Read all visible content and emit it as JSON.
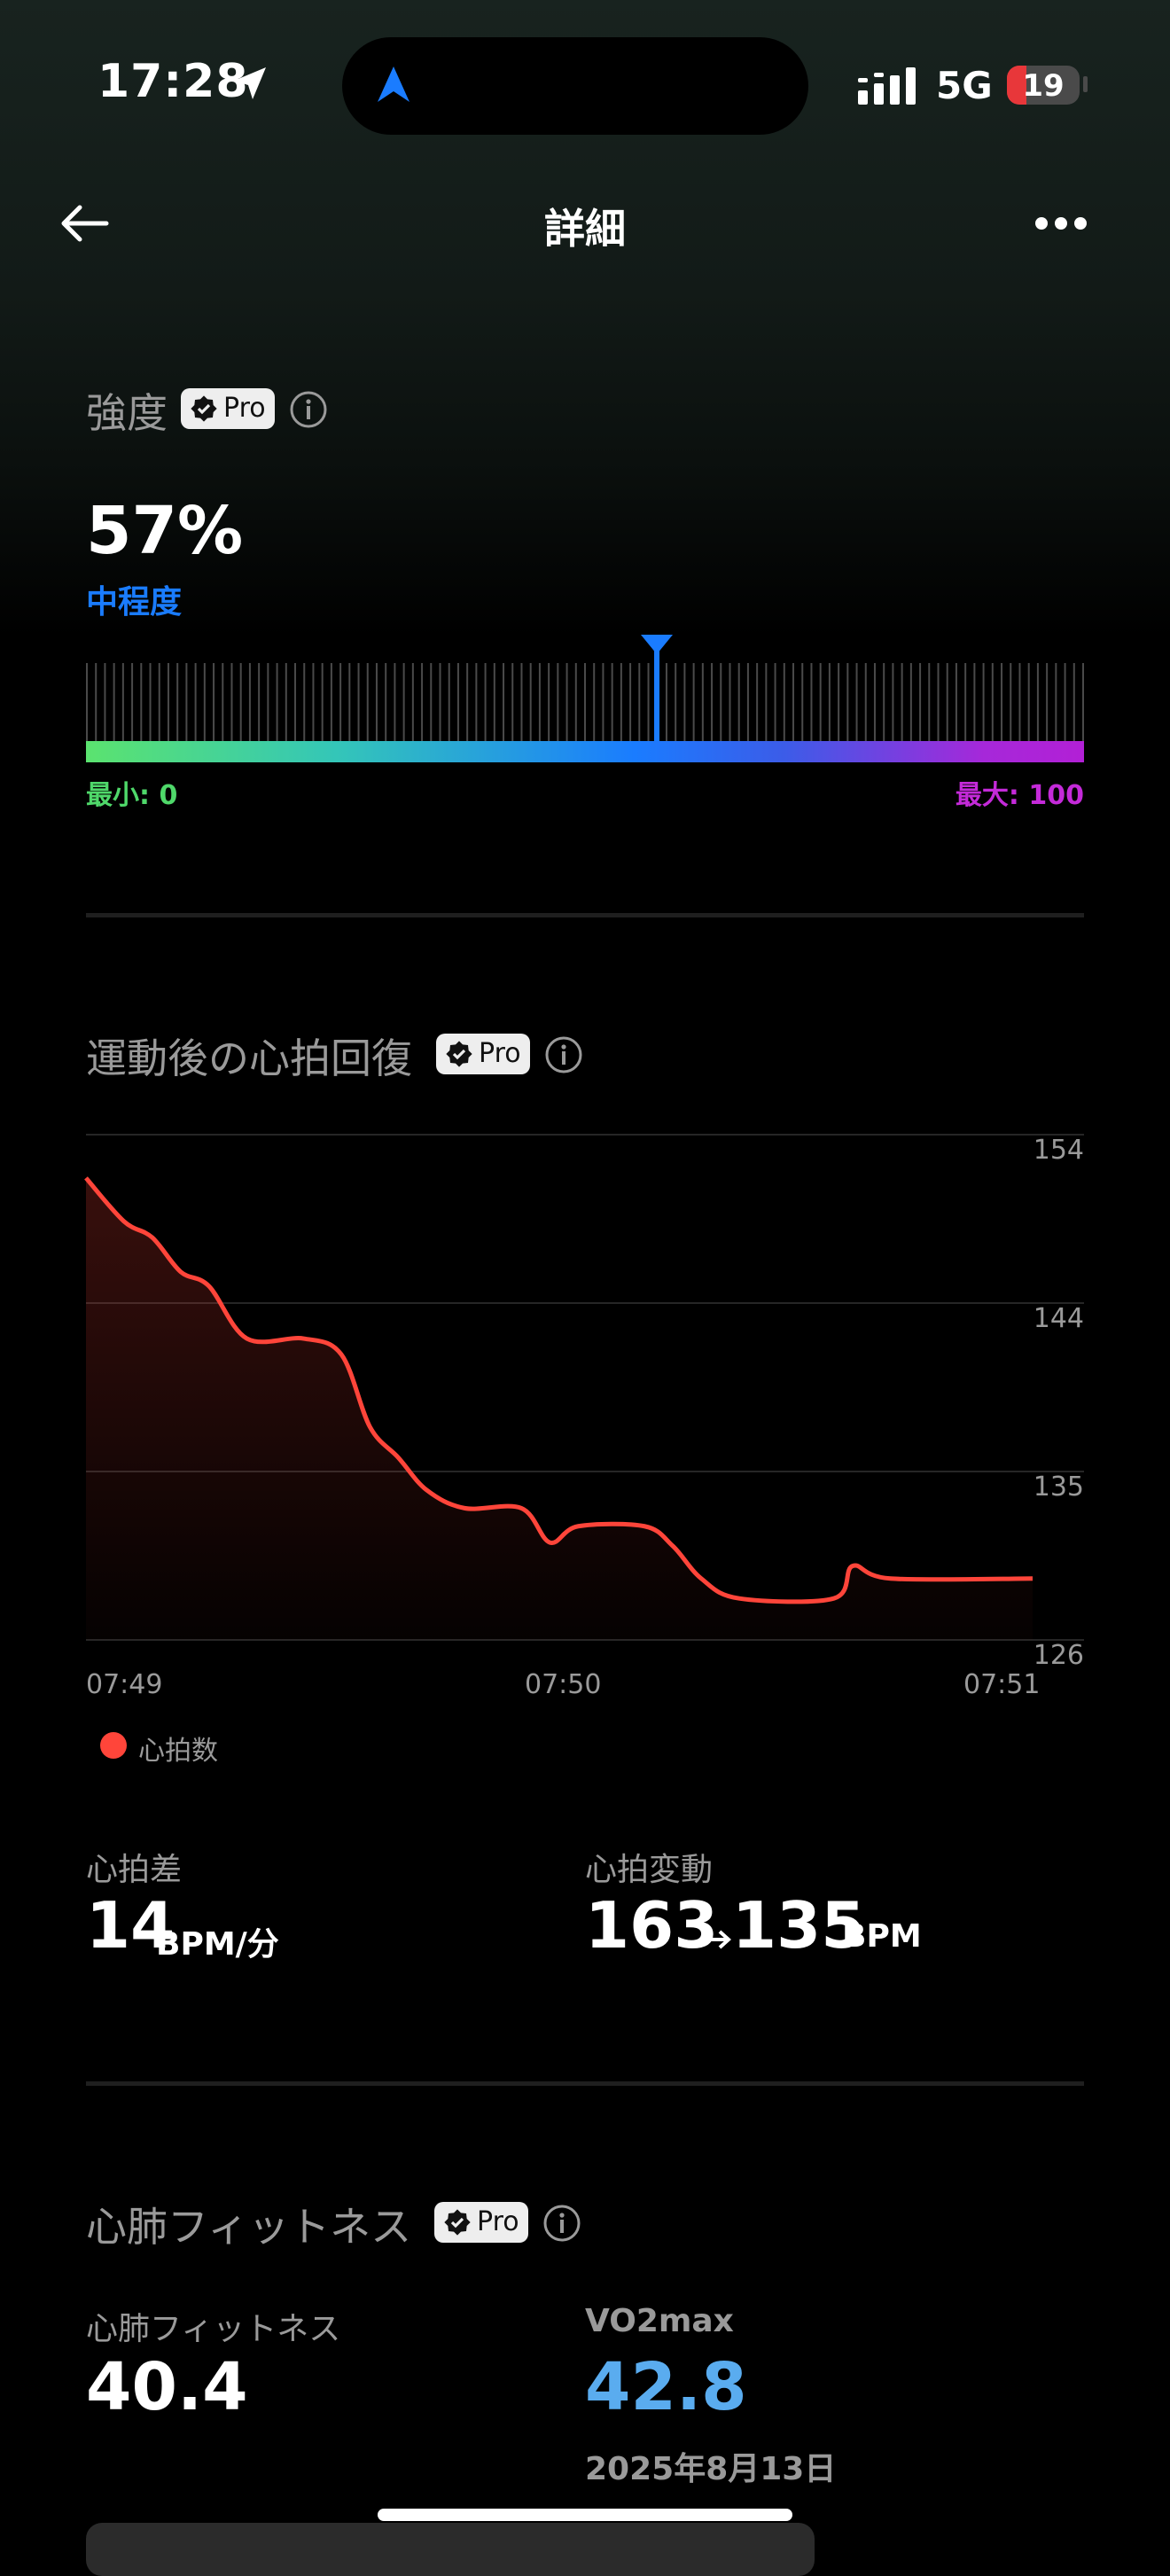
{
  "status_bar": {
    "time": "17:28",
    "network": "5G",
    "battery": "19"
  },
  "nav": {
    "title": "詳細"
  },
  "pro_label": "Pro",
  "intensity": {
    "title": "強度",
    "value": "57%",
    "level": "中程度",
    "gauge_level_percent": 57,
    "min_label": "最小: 0",
    "max_label": "最大: 100"
  },
  "recovery": {
    "title": "運動後の心拍回復",
    "chart_data": {
      "type": "area",
      "series": [
        {
          "name": "心拍数",
          "color": "#ff453a",
          "points": [
            [
              0,
              151.6
            ],
            [
              4,
              149.2
            ],
            [
              7,
              148.3
            ],
            [
              10,
              146.4
            ],
            [
              13,
              145.6
            ],
            [
              17,
              142.7
            ],
            [
              23,
              142.7
            ],
            [
              27,
              141.8
            ],
            [
              30,
              137.8
            ],
            [
              33,
              136.1
            ],
            [
              36,
              134.3
            ],
            [
              40,
              133.3
            ],
            [
              46,
              133.3
            ],
            [
              49,
              131.4
            ],
            [
              52,
              132.3
            ],
            [
              59,
              132.3
            ],
            [
              62,
              131.2
            ],
            [
              65,
              129.4
            ],
            [
              69,
              128.3
            ],
            [
              79,
              128.3
            ],
            [
              81,
              130.1
            ],
            [
              85,
              129.4
            ],
            [
              100,
              129.4
            ]
          ]
        }
      ],
      "x_ticks": [
        "07:49",
        "07:50",
        "07:51"
      ],
      "y_ticks": [
        "154",
        "144",
        "135",
        "126"
      ],
      "ylim": [
        126,
        154
      ],
      "grid": true,
      "legend": "bottom-left"
    },
    "legend_label": "心拍数",
    "hr_diff_label": "心拍差",
    "hr_diff_value": "14",
    "hr_diff_unit": "BPM/分",
    "hr_change_label": "心拍変動",
    "hr_change_from": "163",
    "hr_change_to": "135",
    "hr_change_unit": "BPM"
  },
  "cardio": {
    "title": "心肺フィットネス",
    "fitness_label": "心肺フィットネス",
    "fitness_value": "40.4",
    "vo2_label": "VO2max",
    "vo2_value": "42.8",
    "vo2_date": "2025年8月13日"
  }
}
